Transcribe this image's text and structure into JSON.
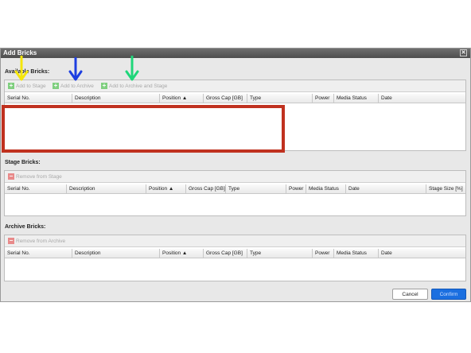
{
  "dialog": {
    "title": "Add Bricks",
    "close_glyph": "✕"
  },
  "available": {
    "label": "Available Bricks:",
    "buttons": {
      "add_to_stage": "Add to Stage",
      "add_to_archive": "Add to Archive",
      "add_to_archive_and_stage": "Add to Archive and Stage"
    },
    "columns": [
      "Serial No.",
      "Description",
      "Position ▲",
      "Gross Cap [GB]",
      "Type",
      "Power",
      "Media Status",
      "Date"
    ]
  },
  "stage": {
    "label": "Stage Bricks:",
    "buttons": {
      "remove": "Remove from Stage"
    },
    "columns": [
      "Serial No.",
      "Description",
      "Position ▲",
      "Gross Cap [GB]",
      "Type",
      "Power",
      "Media Status",
      "Date",
      "Stage Size [%]"
    ]
  },
  "archive": {
    "label": "Archive Bricks:",
    "buttons": {
      "remove": "Remove from Archive"
    },
    "columns": [
      "Serial No.",
      "Description",
      "Position ▲",
      "Gross Cap [GB]",
      "Type",
      "Power",
      "Media Status",
      "Date"
    ]
  },
  "footer": {
    "cancel": "Cancel",
    "confirm": "Confirm"
  },
  "annotations": {
    "arrow_colors": [
      "#f5e60a",
      "#1d3ee0",
      "#1fd67a"
    ],
    "highlight_color": "#c0311f",
    "icons": [
      "plus-icon",
      "minus-icon",
      "sort-ascending-icon",
      "close-icon",
      "arrow-down-icon"
    ]
  }
}
